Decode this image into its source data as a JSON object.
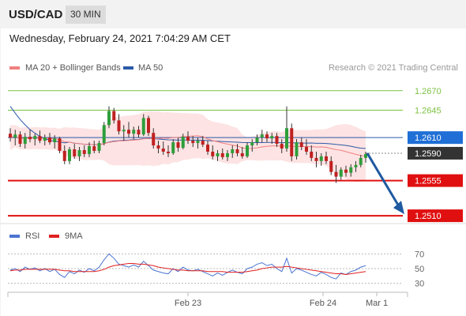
{
  "header": {
    "pair": "USD/CAD",
    "timeframe": "30 MIN"
  },
  "timestamp": "Wednesday, February 24, 2021 7:04:29 AM CET",
  "legend_main": [
    {
      "label": "MA 20 + Bollinger Bands",
      "color": "#f08080"
    },
    {
      "label": "MA 50",
      "color": "#2b5aa8"
    }
  ],
  "credit": "Research © 2021 Trading Central",
  "legend_rsi": [
    {
      "label": "RSI",
      "color": "#4a74d1"
    },
    {
      "label": "9MA",
      "color": "#e02020"
    }
  ],
  "colors": {
    "up": "#2e9e3a",
    "down": "#c02020",
    "resistance": "#7cc242",
    "support": "#e01010",
    "ma50": "#2b5aa8",
    "ma20": "#f08080",
    "band": "#fde3e3",
    "arrow": "#1f5aa0"
  },
  "chart_data": [
    {
      "type": "candlestick",
      "title": "USD/CAD 30 MIN",
      "x_ticks": [
        "Feb 23",
        "Feb 24",
        "Mar 1"
      ],
      "ylim": [
        1.25,
        1.269
      ],
      "levels": [
        {
          "value": 1.267,
          "label": "1.2670",
          "kind": "resistance"
        },
        {
          "value": 1.2645,
          "label": "1.2645",
          "kind": "resistance"
        },
        {
          "value": 1.261,
          "label": "1.2610",
          "kind": "pivot"
        },
        {
          "value": 1.259,
          "label": "1.2590",
          "kind": "last"
        },
        {
          "value": 1.2555,
          "label": "1.2555",
          "kind": "support"
        },
        {
          "value": 1.251,
          "label": "1.2510",
          "kind": "support"
        }
      ],
      "projection": {
        "from": 1.259,
        "to": 1.251
      },
      "candles": [
        [
          1.2615,
          1.2622,
          1.2605,
          1.261
        ],
        [
          1.261,
          1.262,
          1.26,
          1.2614
        ],
        [
          1.2614,
          1.2618,
          1.2598,
          1.2602
        ],
        [
          1.2602,
          1.2616,
          1.2596,
          1.2611
        ],
        [
          1.2611,
          1.262,
          1.2604,
          1.2608
        ],
        [
          1.2608,
          1.2615,
          1.26,
          1.2612
        ],
        [
          1.2612,
          1.2619,
          1.2603,
          1.2606
        ],
        [
          1.2606,
          1.2614,
          1.26,
          1.261
        ],
        [
          1.261,
          1.2616,
          1.2601,
          1.2604
        ],
        [
          1.2604,
          1.2613,
          1.2596,
          1.2609
        ],
        [
          1.2609,
          1.2611,
          1.259,
          1.2593
        ],
        [
          1.2593,
          1.26,
          1.2576,
          1.258
        ],
        [
          1.258,
          1.2598,
          1.2576,
          1.2595
        ],
        [
          1.2595,
          1.2602,
          1.2583,
          1.2586
        ],
        [
          1.2586,
          1.2598,
          1.258,
          1.2594
        ],
        [
          1.2594,
          1.26,
          1.2585,
          1.2589
        ],
        [
          1.2589,
          1.2604,
          1.2585,
          1.2599
        ],
        [
          1.2599,
          1.2606,
          1.259,
          1.2593
        ],
        [
          1.2593,
          1.2606,
          1.259,
          1.2603
        ],
        [
          1.2603,
          1.263,
          1.26,
          1.2626
        ],
        [
          1.2626,
          1.265,
          1.2622,
          1.2644
        ],
        [
          1.2644,
          1.2648,
          1.2628,
          1.2632
        ],
        [
          1.2632,
          1.264,
          1.2614,
          1.2618
        ],
        [
          1.2618,
          1.2626,
          1.2606,
          1.262
        ],
        [
          1.262,
          1.263,
          1.261,
          1.2615
        ],
        [
          1.2615,
          1.2624,
          1.2608,
          1.262
        ],
        [
          1.262,
          1.2625,
          1.261,
          1.2614
        ],
        [
          1.2614,
          1.264,
          1.2612,
          1.2635
        ],
        [
          1.2635,
          1.2638,
          1.2612,
          1.2616
        ],
        [
          1.2616,
          1.2622,
          1.2596,
          1.26
        ],
        [
          1.26,
          1.2606,
          1.259,
          1.2596
        ],
        [
          1.2596,
          1.2605,
          1.2588,
          1.2592
        ],
        [
          1.2592,
          1.26,
          1.2585,
          1.259
        ],
        [
          1.259,
          1.2608,
          1.2588,
          1.2604
        ],
        [
          1.2604,
          1.261,
          1.2592,
          1.2597
        ],
        [
          1.2597,
          1.2615,
          1.2595,
          1.2611
        ],
        [
          1.2611,
          1.2618,
          1.2602,
          1.2606
        ],
        [
          1.2606,
          1.2612,
          1.2598,
          1.2603
        ],
        [
          1.2603,
          1.261,
          1.2596,
          1.2606
        ],
        [
          1.2606,
          1.2612,
          1.2598,
          1.2601
        ],
        [
          1.2601,
          1.2606,
          1.2588,
          1.2592
        ],
        [
          1.2592,
          1.26,
          1.2582,
          1.2586
        ],
        [
          1.2586,
          1.2594,
          1.258,
          1.259
        ],
        [
          1.259,
          1.2596,
          1.2582,
          1.2585
        ],
        [
          1.2585,
          1.2594,
          1.258,
          1.259
        ],
        [
          1.259,
          1.26,
          1.2584,
          1.2595
        ],
        [
          1.2595,
          1.2602,
          1.2586,
          1.259
        ],
        [
          1.259,
          1.2598,
          1.2583,
          1.2586
        ],
        [
          1.2586,
          1.2604,
          1.2584,
          1.26
        ],
        [
          1.26,
          1.2608,
          1.2592,
          1.2604
        ],
        [
          1.2604,
          1.2614,
          1.26,
          1.261
        ],
        [
          1.261,
          1.262,
          1.2604,
          1.2614
        ],
        [
          1.2614,
          1.2618,
          1.2604,
          1.2609
        ],
        [
          1.2609,
          1.2616,
          1.2602,
          1.2612
        ],
        [
          1.2612,
          1.2616,
          1.2598,
          1.2602
        ],
        [
          1.2602,
          1.2608,
          1.259,
          1.2596
        ],
        [
          1.2596,
          1.265,
          1.2592,
          1.2622
        ],
        [
          1.2622,
          1.2628,
          1.258,
          1.2586
        ],
        [
          1.2586,
          1.2608,
          1.2582,
          1.2604
        ],
        [
          1.2604,
          1.261,
          1.2594,
          1.2598
        ],
        [
          1.2598,
          1.2608,
          1.2588,
          1.2592
        ],
        [
          1.2592,
          1.26,
          1.258,
          1.2584
        ],
        [
          1.2584,
          1.2592,
          1.2572,
          1.258
        ],
        [
          1.258,
          1.259,
          1.2574,
          1.2586
        ],
        [
          1.2586,
          1.2592,
          1.2576,
          1.258
        ],
        [
          1.258,
          1.2586,
          1.2562,
          1.2566
        ],
        [
          1.2566,
          1.2575,
          1.2552,
          1.256
        ],
        [
          1.256,
          1.2572,
          1.2556,
          1.2569
        ],
        [
          1.2569,
          1.2574,
          1.256,
          1.2565
        ],
        [
          1.2565,
          1.2576,
          1.256,
          1.2572
        ],
        [
          1.2572,
          1.258,
          1.2566,
          1.2575
        ],
        [
          1.2575,
          1.2588,
          1.2572,
          1.2584
        ],
        [
          1.2584,
          1.2592,
          1.2578,
          1.2589
        ]
      ]
    },
    {
      "type": "line",
      "title": "RSI",
      "ylim": [
        20,
        80
      ],
      "y_ticks": [
        70,
        50,
        30
      ],
      "series": [
        {
          "name": "RSI",
          "values": [
            48,
            50,
            46,
            52,
            49,
            51,
            47,
            50,
            46,
            49,
            42,
            38,
            46,
            43,
            48,
            45,
            50,
            47,
            52,
            62,
            70,
            64,
            56,
            54,
            52,
            55,
            52,
            60,
            54,
            48,
            46,
            44,
            43,
            50,
            46,
            52,
            48,
            47,
            49,
            46,
            43,
            40,
            44,
            41,
            45,
            48,
            45,
            43,
            50,
            52,
            56,
            58,
            54,
            56,
            50,
            46,
            64,
            44,
            50,
            48,
            45,
            42,
            40,
            45,
            42,
            38,
            36,
            44,
            42,
            46,
            48,
            52,
            54
          ]
        },
        {
          "name": "9MA",
          "values": [
            47,
            48,
            48,
            49,
            49,
            49,
            49,
            49,
            49,
            49,
            48,
            47,
            47,
            46,
            46,
            46,
            46,
            46,
            47,
            49,
            52,
            54,
            55,
            56,
            57,
            57,
            56,
            56,
            55,
            54,
            52,
            51,
            50,
            49,
            48,
            48,
            47,
            47,
            47,
            47,
            46,
            46,
            46,
            46,
            45,
            45,
            45,
            45,
            46,
            47,
            48,
            50,
            51,
            52,
            52,
            52,
            53,
            52,
            51,
            50,
            49,
            48,
            47,
            46,
            45,
            44,
            43,
            43,
            42,
            43,
            44,
            45,
            46
          ]
        }
      ]
    }
  ]
}
